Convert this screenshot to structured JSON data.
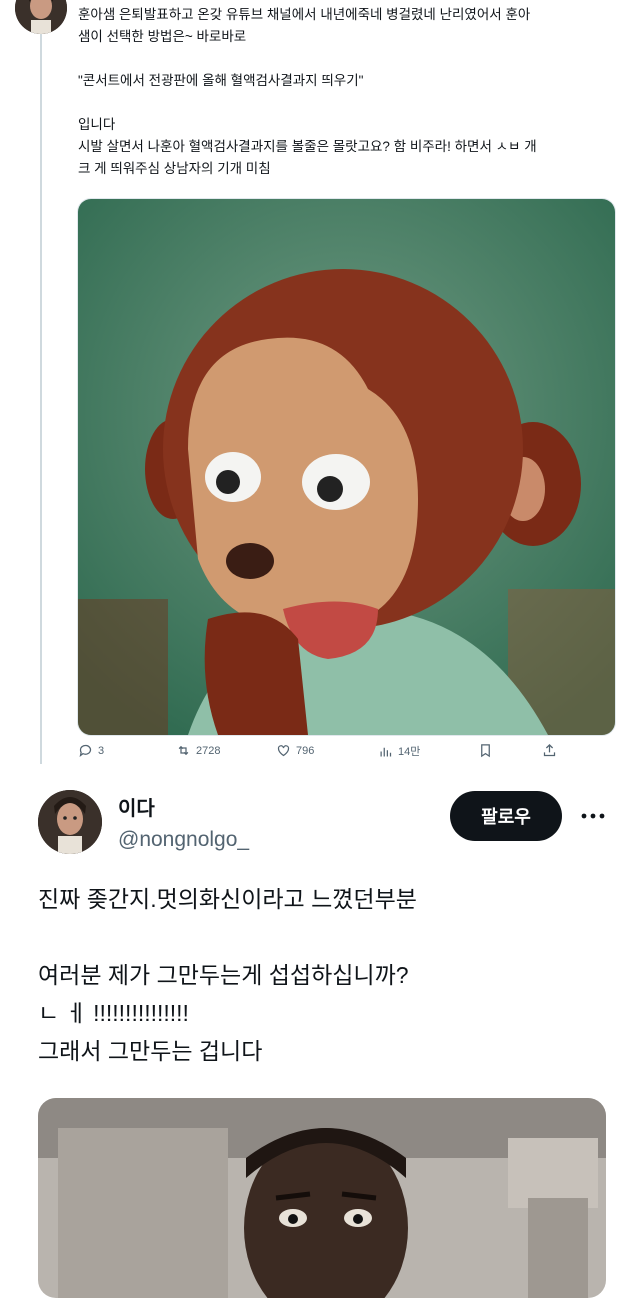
{
  "tweet1": {
    "text_lines": [
      "훈아샘 은퇴발표하고 온갖 유튜브 채널에서 내년에죽네 병걸렸네 난리였어서 훈아",
      "샘이 선택한 방법은~ 바로바로",
      "\"콘서트에서 전광판에 올해 혈액검사결과지 띄우기\"",
      "입니다",
      "시발 살면서 나훈아 혈액검사결과지를 볼줄은 몰랏고요? 함 비주라! 하면서 ㅅㅂ 개",
      "크 게 띄워주심 상남자의 기개 미침"
    ],
    "media_icon": "puppet-monkey-image",
    "actions": {
      "reply_count": "3",
      "retweet_count": "2728",
      "like_count": "796",
      "view_count": "14만"
    }
  },
  "tweet2": {
    "display_name": "이다",
    "handle": "@nongnolgo_",
    "follow_label": "팔로우",
    "text_lines": [
      "진짜 좆간지.멋의화신이라고 느꼈던부분",
      "여러분 제가 그만두는게 섭섭하십니까?",
      "ㄴ ㅔ !!!!!!!!!!!!!!!",
      "그래서 그만두는 겁니다"
    ],
    "media_icon": "shocked-man-image"
  },
  "colors": {
    "text": "#0f1419",
    "secondary": "#536471",
    "button_bg": "#0f1419",
    "divider": "#cfd9de"
  }
}
